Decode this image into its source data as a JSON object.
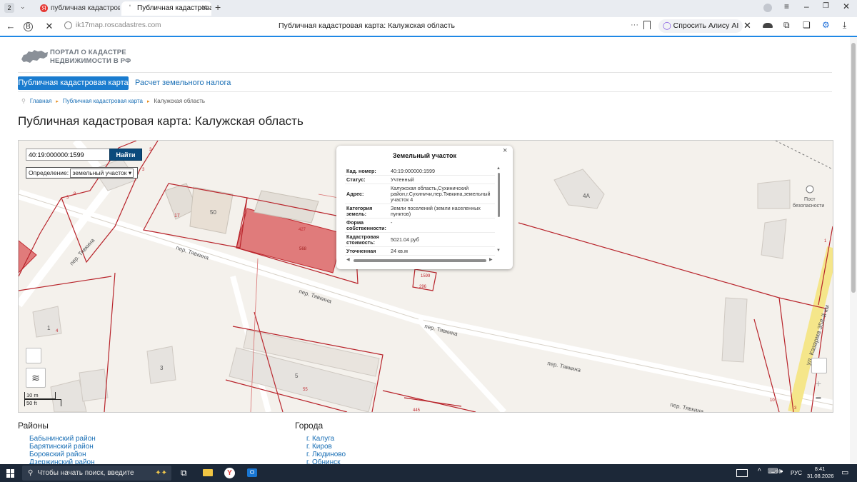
{
  "browser": {
    "tab_counter": "2",
    "tabs": [
      {
        "label": "публичная кадастровая к"
      },
      {
        "label": "Публичная кадастрова"
      }
    ],
    "url_host": "ik17map.roscadastres.com",
    "page_title": "Публичная кадастровая карта: Калужская область",
    "alice_label": "Спросить Алису AI"
  },
  "header": {
    "logo_line1": "ПОРТАЛ О КАДАСТРЕ",
    "logo_line2": "НЕДВИЖИМОСТИ В РФ"
  },
  "nav": {
    "active": "Публичная кадастровая карта",
    "tax": "Расчет земельного налога"
  },
  "breadcrumb": {
    "home": "Главная",
    "map": "Публичная кадастровая карта",
    "current": "Калужская область"
  },
  "title": "Публичная кадастровая карта: Калужская область",
  "map": {
    "search_value": "40:19:000000:1599",
    "search_button": "Найти",
    "definition_label": "Определение:",
    "definition_value": "земельный участок",
    "scale_m": "10 m",
    "scale_ft": "50 ft",
    "labels": {
      "street1": "пер. Тявкина",
      "street2": "пер. Тявкина",
      "street3": "пер. Тявкина",
      "street4": "пер. Тявкина",
      "street5": "пер. Тявкина",
      "street6": "пер. Тявкина",
      "road": "ул. Казарма 358-й км",
      "post": "Пост",
      "post2": "безопасности",
      "b50": "50",
      "b17": "17",
      "b427": "427",
      "b568": "568",
      "b4a": "4А",
      "b5": "5",
      "b55": "55",
      "b3a": "3",
      "b3b": "3",
      "b8": "8",
      "b1": "1",
      "b4": "4",
      "b3c": "3",
      "b1599": "1599",
      "b296": "296",
      "b10": "10",
      "b3d": "3",
      "b1r": "1",
      "b445": "445"
    },
    "popup": {
      "title": "Земельный участок",
      "rows": [
        {
          "key": "Кад. номер:",
          "value": "40:19:000000:1599"
        },
        {
          "key": "Статус:",
          "value": "Учтенный"
        },
        {
          "key": "Адрес:",
          "value": "Калужская область,Сухиничский район,г.Сухиничи,пер.Тявкина,земельный участок 4"
        },
        {
          "key": "Категория земель:",
          "value": "Земли поселений (земли населенных пунктов)"
        },
        {
          "key": "Форма собственности:",
          "value": "-"
        },
        {
          "key": "Кадастровая стоимость:",
          "value": "5021.04 руб"
        },
        {
          "key": "Уточненная",
          "value": "24 кв.м"
        }
      ]
    }
  },
  "districts": {
    "title": "Районы",
    "items": [
      "Бабынинский район",
      "Барятинский район",
      "Боровский район",
      "Дзержинский район"
    ]
  },
  "cities": {
    "title": "Города",
    "items": [
      "г. Калуга",
      "г. Киров",
      "г. Людиново",
      "г. Обнинск"
    ]
  },
  "taskbar": {
    "search_placeholder": "Чтобы начать поиск, введите",
    "lang": "РУС",
    "time": "8:41",
    "date": "31.08.2026"
  },
  "colors": {
    "accent": "#1a7ccf",
    "parcel_fill": "#e07b7b",
    "parcel_border": "#c0282f",
    "taskbar": "#1c2838"
  }
}
